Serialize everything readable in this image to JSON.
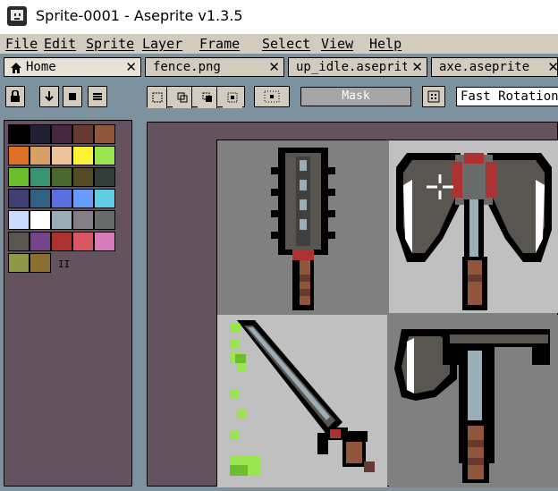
{
  "window": {
    "title": "Sprite-0001 - Aseprite v1.3.5"
  },
  "menu": {
    "items": [
      "File",
      "Edit",
      "Sprite",
      "Layer",
      "Frame",
      "Select",
      "View",
      "Help"
    ]
  },
  "tabs": [
    {
      "label": "Home",
      "icon": "home-icon"
    },
    {
      "label": "fence.png"
    },
    {
      "label": "up_idle.aseprite"
    },
    {
      "label": "axe.aseprite"
    }
  ],
  "toolbar": {
    "mask_label": "Mask",
    "rotation_algorithm": "Fast Rotation"
  },
  "palette": {
    "colors": [
      "#000000",
      "#222034",
      "#45283c",
      "#663931",
      "#8f563b",
      "#df7126",
      "#d9a066",
      "#eec39a",
      "#fbf236",
      "#99e550",
      "#6abe30",
      "#37946e",
      "#4b692f",
      "#524b24",
      "#323c39",
      "#3f3f74",
      "#306082",
      "#5b6ee1",
      "#639bff",
      "#5fcde4",
      "#cbdbfc",
      "#ffffff",
      "#9badb7",
      "#847e87",
      "#696a6a",
      "#595652",
      "#76428a",
      "#ac3232",
      "#d95763",
      "#d77bba",
      "#8f974a",
      "#8a6f30"
    ]
  },
  "canvas": {
    "colors": {
      "quad_bg_dark": "#808080",
      "quad_bg_light": "#c0c0c0",
      "metal": "#595652",
      "metal_light": "#9badb7",
      "blood": "#ac3232",
      "handle": "#8f563b",
      "outline": "#000000",
      "green": "#99e550"
    }
  }
}
